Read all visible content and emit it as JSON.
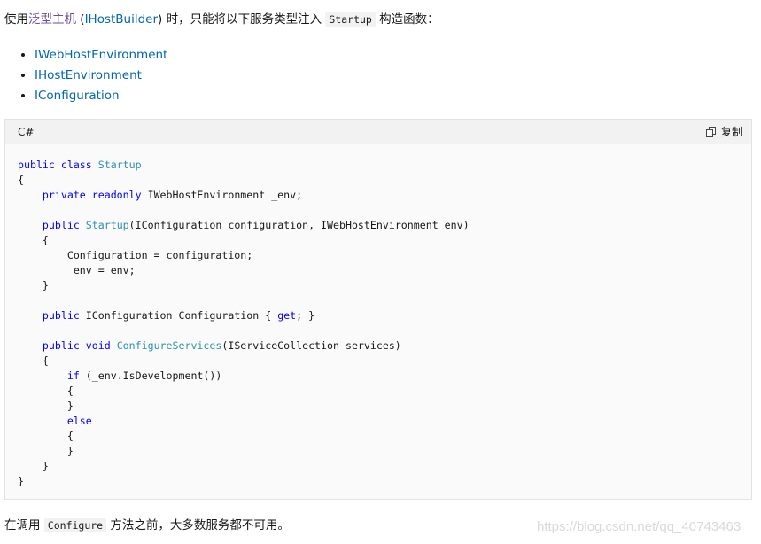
{
  "intro": {
    "prefix": "使用",
    "generic_host_link": "泛型主机",
    "open_paren": " (",
    "ihostbuilder_link": "IHostBuilder",
    "after_builder": ") 时，只能将以下服务类型注入 ",
    "startup_code": "Startup",
    "suffix": " 构造函数："
  },
  "service_types": [
    "IWebHostEnvironment",
    "IHostEnvironment",
    "IConfiguration"
  ],
  "code_block": {
    "language": "C#",
    "copy_label": "复制",
    "lines": [
      [
        {
          "t": "public class ",
          "c": "kw"
        },
        {
          "t": "Startup",
          "c": "ty"
        }
      ],
      [
        {
          "t": "{"
        }
      ],
      [
        {
          "t": "    "
        },
        {
          "t": "private readonly ",
          "c": "kw"
        },
        {
          "t": "IWebHostEnvironment _env;"
        }
      ],
      [
        {
          "t": ""
        }
      ],
      [
        {
          "t": "    "
        },
        {
          "t": "public ",
          "c": "kw"
        },
        {
          "t": "Startup",
          "c": "ty"
        },
        {
          "t": "(IConfiguration configuration, IWebHostEnvironment env)"
        }
      ],
      [
        {
          "t": "    {"
        }
      ],
      [
        {
          "t": "        Configuration = configuration;"
        }
      ],
      [
        {
          "t": "        _env = env;"
        }
      ],
      [
        {
          "t": "    }"
        }
      ],
      [
        {
          "t": ""
        }
      ],
      [
        {
          "t": "    "
        },
        {
          "t": "public ",
          "c": "kw"
        },
        {
          "t": "IConfiguration Configuration { "
        },
        {
          "t": "get",
          "c": "kw"
        },
        {
          "t": "; }"
        }
      ],
      [
        {
          "t": ""
        }
      ],
      [
        {
          "t": "    "
        },
        {
          "t": "public void ",
          "c": "kw"
        },
        {
          "t": "ConfigureServices",
          "c": "ty"
        },
        {
          "t": "(IServiceCollection services)"
        }
      ],
      [
        {
          "t": "    {"
        }
      ],
      [
        {
          "t": "        "
        },
        {
          "t": "if",
          "c": "kw"
        },
        {
          "t": " (_env.IsDevelopment())"
        }
      ],
      [
        {
          "t": "        {"
        }
      ],
      [
        {
          "t": "        }"
        }
      ],
      [
        {
          "t": "        "
        },
        {
          "t": "else",
          "c": "kw"
        }
      ],
      [
        {
          "t": "        {"
        }
      ],
      [
        {
          "t": "        }"
        }
      ],
      [
        {
          "t": "    }"
        }
      ],
      [
        {
          "t": "}"
        }
      ]
    ]
  },
  "outro": {
    "prefix": "在调用 ",
    "configure_code": "Configure",
    "suffix": " 方法之前，大多数服务都不可用。"
  },
  "watermark": "https://blog.csdn.net/qq_40743463"
}
